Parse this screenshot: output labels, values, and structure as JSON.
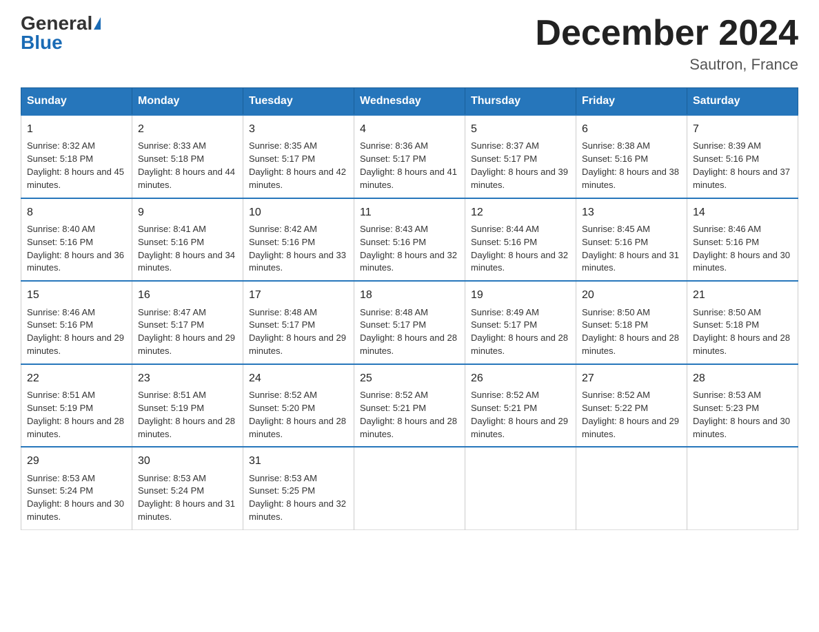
{
  "header": {
    "logo_general": "General",
    "logo_blue": "Blue",
    "month_title": "December 2024",
    "location": "Sautron, France"
  },
  "days_of_week": [
    "Sunday",
    "Monday",
    "Tuesday",
    "Wednesday",
    "Thursday",
    "Friday",
    "Saturday"
  ],
  "weeks": [
    [
      {
        "day": "1",
        "sunrise": "8:32 AM",
        "sunset": "5:18 PM",
        "daylight": "8 hours and 45 minutes."
      },
      {
        "day": "2",
        "sunrise": "8:33 AM",
        "sunset": "5:18 PM",
        "daylight": "8 hours and 44 minutes."
      },
      {
        "day": "3",
        "sunrise": "8:35 AM",
        "sunset": "5:17 PM",
        "daylight": "8 hours and 42 minutes."
      },
      {
        "day": "4",
        "sunrise": "8:36 AM",
        "sunset": "5:17 PM",
        "daylight": "8 hours and 41 minutes."
      },
      {
        "day": "5",
        "sunrise": "8:37 AM",
        "sunset": "5:17 PM",
        "daylight": "8 hours and 39 minutes."
      },
      {
        "day": "6",
        "sunrise": "8:38 AM",
        "sunset": "5:16 PM",
        "daylight": "8 hours and 38 minutes."
      },
      {
        "day": "7",
        "sunrise": "8:39 AM",
        "sunset": "5:16 PM",
        "daylight": "8 hours and 37 minutes."
      }
    ],
    [
      {
        "day": "8",
        "sunrise": "8:40 AM",
        "sunset": "5:16 PM",
        "daylight": "8 hours and 36 minutes."
      },
      {
        "day": "9",
        "sunrise": "8:41 AM",
        "sunset": "5:16 PM",
        "daylight": "8 hours and 34 minutes."
      },
      {
        "day": "10",
        "sunrise": "8:42 AM",
        "sunset": "5:16 PM",
        "daylight": "8 hours and 33 minutes."
      },
      {
        "day": "11",
        "sunrise": "8:43 AM",
        "sunset": "5:16 PM",
        "daylight": "8 hours and 32 minutes."
      },
      {
        "day": "12",
        "sunrise": "8:44 AM",
        "sunset": "5:16 PM",
        "daylight": "8 hours and 32 minutes."
      },
      {
        "day": "13",
        "sunrise": "8:45 AM",
        "sunset": "5:16 PM",
        "daylight": "8 hours and 31 minutes."
      },
      {
        "day": "14",
        "sunrise": "8:46 AM",
        "sunset": "5:16 PM",
        "daylight": "8 hours and 30 minutes."
      }
    ],
    [
      {
        "day": "15",
        "sunrise": "8:46 AM",
        "sunset": "5:16 PM",
        "daylight": "8 hours and 29 minutes."
      },
      {
        "day": "16",
        "sunrise": "8:47 AM",
        "sunset": "5:17 PM",
        "daylight": "8 hours and 29 minutes."
      },
      {
        "day": "17",
        "sunrise": "8:48 AM",
        "sunset": "5:17 PM",
        "daylight": "8 hours and 29 minutes."
      },
      {
        "day": "18",
        "sunrise": "8:48 AM",
        "sunset": "5:17 PM",
        "daylight": "8 hours and 28 minutes."
      },
      {
        "day": "19",
        "sunrise": "8:49 AM",
        "sunset": "5:17 PM",
        "daylight": "8 hours and 28 minutes."
      },
      {
        "day": "20",
        "sunrise": "8:50 AM",
        "sunset": "5:18 PM",
        "daylight": "8 hours and 28 minutes."
      },
      {
        "day": "21",
        "sunrise": "8:50 AM",
        "sunset": "5:18 PM",
        "daylight": "8 hours and 28 minutes."
      }
    ],
    [
      {
        "day": "22",
        "sunrise": "8:51 AM",
        "sunset": "5:19 PM",
        "daylight": "8 hours and 28 minutes."
      },
      {
        "day": "23",
        "sunrise": "8:51 AM",
        "sunset": "5:19 PM",
        "daylight": "8 hours and 28 minutes."
      },
      {
        "day": "24",
        "sunrise": "8:52 AM",
        "sunset": "5:20 PM",
        "daylight": "8 hours and 28 minutes."
      },
      {
        "day": "25",
        "sunrise": "8:52 AM",
        "sunset": "5:21 PM",
        "daylight": "8 hours and 28 minutes."
      },
      {
        "day": "26",
        "sunrise": "8:52 AM",
        "sunset": "5:21 PM",
        "daylight": "8 hours and 29 minutes."
      },
      {
        "day": "27",
        "sunrise": "8:52 AM",
        "sunset": "5:22 PM",
        "daylight": "8 hours and 29 minutes."
      },
      {
        "day": "28",
        "sunrise": "8:53 AM",
        "sunset": "5:23 PM",
        "daylight": "8 hours and 30 minutes."
      }
    ],
    [
      {
        "day": "29",
        "sunrise": "8:53 AM",
        "sunset": "5:24 PM",
        "daylight": "8 hours and 30 minutes."
      },
      {
        "day": "30",
        "sunrise": "8:53 AM",
        "sunset": "5:24 PM",
        "daylight": "8 hours and 31 minutes."
      },
      {
        "day": "31",
        "sunrise": "8:53 AM",
        "sunset": "5:25 PM",
        "daylight": "8 hours and 32 minutes."
      },
      null,
      null,
      null,
      null
    ]
  ]
}
